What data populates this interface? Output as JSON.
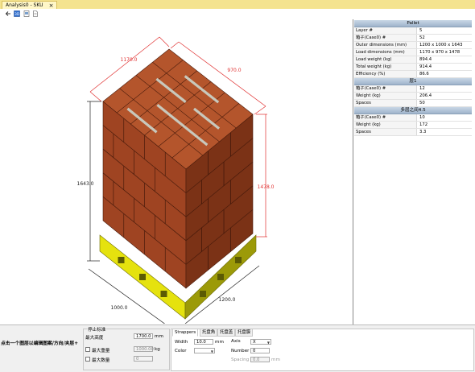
{
  "window": {
    "tab_title": "Analysis0 - SKU",
    "tab_close": "×"
  },
  "toolbar": {
    "icons": [
      "back-icon",
      "3d-view-icon",
      "save-image-icon",
      "export-document-icon"
    ]
  },
  "drawing": {
    "dim_length": "1170.0",
    "dim_width": "970.0",
    "dim_height_overall": "1643.0",
    "dim_height_load": "1478.0",
    "pallet_length": "1200.0",
    "pallet_width": "1000.0",
    "colors": {
      "box": "#9f4422",
      "box_dark": "#7b3216",
      "box_light": "#b4552c",
      "strap": "#c8c8bc",
      "pallet": "#e5e20e",
      "pallet_dark": "#9c9a08",
      "dim_red": "#e03030",
      "dim_black": "#222222"
    }
  },
  "properties": {
    "sections": [
      {
        "title": "Pallet",
        "rows": [
          {
            "k": "Layer #",
            "v": "5"
          },
          {
            "k": "箱子(Case0) #",
            "v": "52"
          },
          {
            "k": "Outer dimensions (mm)",
            "v": "1200 x 1000 x 1643"
          },
          {
            "k": "Load dimensions (mm)",
            "v": "1170 x 970 x 1478"
          },
          {
            "k": "Load weight (kg)",
            "v": "894.4"
          },
          {
            "k": "Total weight (kg)",
            "v": "914.4"
          },
          {
            "k": "Efficiency (%)",
            "v": "86.6"
          }
        ]
      },
      {
        "title": "层1",
        "rows": [
          {
            "k": "箱子(Case0) #",
            "v": "12"
          },
          {
            "k": "Weight (kg)",
            "v": "206.4"
          },
          {
            "k": "Spaces",
            "v": "50"
          }
        ]
      },
      {
        "title": "多层之间4.5",
        "rows": [
          {
            "k": "箱子(Case0) #",
            "v": "10"
          },
          {
            "k": "Weight (kg)",
            "v": "172"
          },
          {
            "k": "Spaces",
            "v": "3.3"
          }
        ]
      }
    ]
  },
  "bottom": {
    "hint": "点击一个图层以编辑图案/方向/夹层+",
    "stop": {
      "title": "停止标准",
      "max_height_label": "最大高度",
      "max_height_value": "1700.0",
      "max_height_unit": "mm",
      "max_weight_label": "最大重量",
      "max_weight_value": "1000.00",
      "max_weight_unit": "kg",
      "max_count_label": "最大数量",
      "max_count_value": "0"
    },
    "tabs": [
      "Strappers",
      "托盘角",
      "托盘盖",
      "托盘膜"
    ],
    "width_label": "Width",
    "width_value": "10.0",
    "width_unit": "mm",
    "color_label": "Color",
    "axis_label": "Axis",
    "axis_value": "X",
    "number_label": "Number",
    "number_value": "0",
    "spacing_label": "Spacing",
    "spacing_value": "0.0",
    "spacing_unit": "mm"
  }
}
